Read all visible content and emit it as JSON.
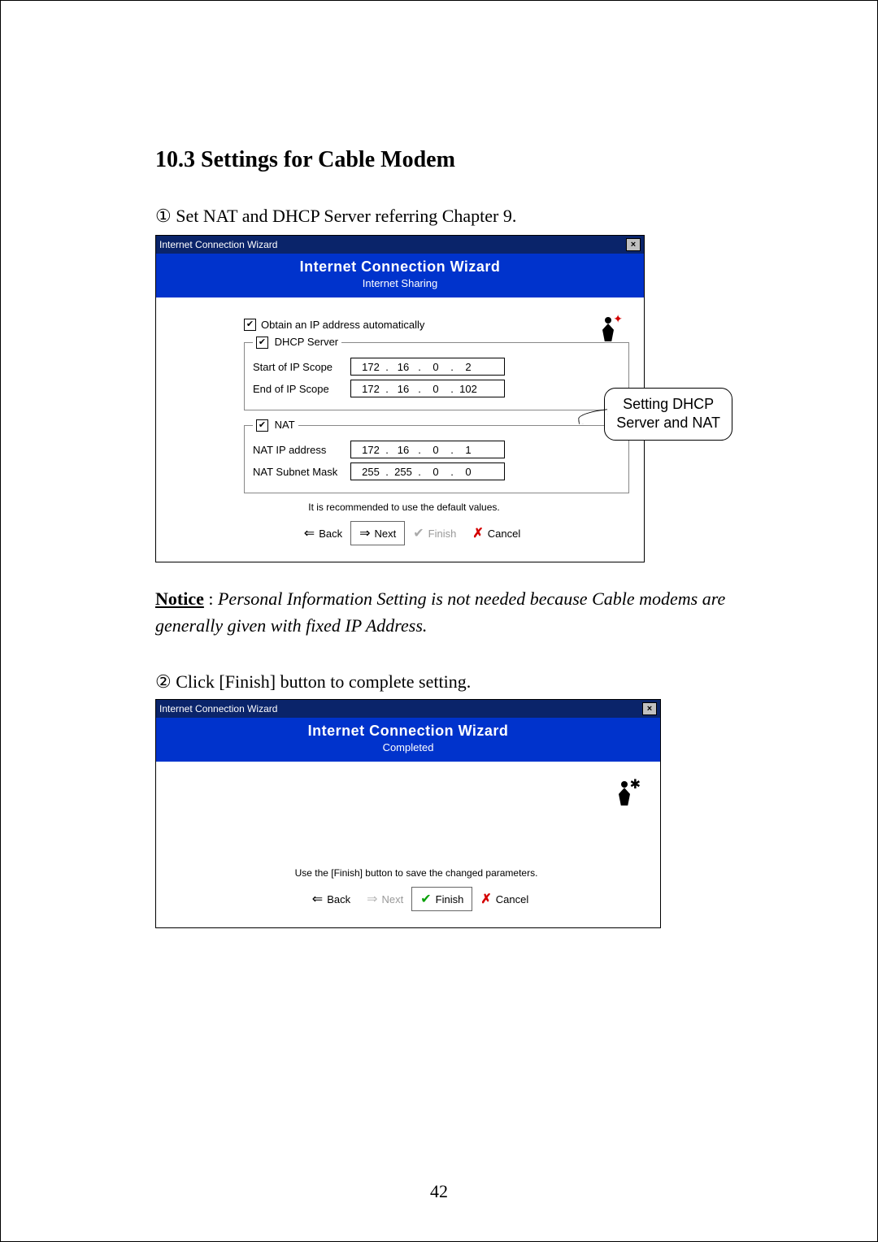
{
  "section_heading": "10.3 Settings for Cable Modem",
  "step1": {
    "num": "①",
    "text": "Set NAT and DHCP Server referring Chapter 9."
  },
  "step2": {
    "num": "②",
    "text": "Click [Finish] button to complete setting."
  },
  "notice": {
    "label": "Notice",
    "sep": " : ",
    "text": "Personal Information Setting is not needed because Cable modems are generally given with fixed IP Address."
  },
  "page_number": "42",
  "callout": {
    "line1": "Setting DHCP",
    "line2": "Server and NAT"
  },
  "dialog1": {
    "title": "Internet Connection Wizard",
    "banner_title": "Internet Connection Wizard",
    "banner_sub": "Internet Sharing",
    "obtain_label": "Obtain an IP address automatically",
    "dhcp_label": "DHCP Server",
    "start_label": "Start of IP Scope",
    "end_label": "End of IP Scope",
    "start_ip": [
      "172",
      "16",
      "0",
      "2"
    ],
    "end_ip": [
      "172",
      "16",
      "0",
      "102"
    ],
    "nat_label": "NAT",
    "nat_ip_label": "NAT IP address",
    "nat_mask_label": "NAT Subnet Mask",
    "nat_ip": [
      "172",
      "16",
      "0",
      "1"
    ],
    "nat_mask": [
      "255",
      "255",
      "0",
      "0"
    ],
    "recommend": "It is recommended to use the default values.",
    "back": "Back",
    "next": "Next",
    "finish": "Finish",
    "cancel": "Cancel"
  },
  "dialog2": {
    "title": "Internet Connection Wizard",
    "banner_title": "Internet Connection Wizard",
    "banner_sub": "Completed",
    "instr": "Use the [Finish] button to save the changed parameters.",
    "back": "Back",
    "next": "Next",
    "finish": "Finish",
    "cancel": "Cancel"
  }
}
